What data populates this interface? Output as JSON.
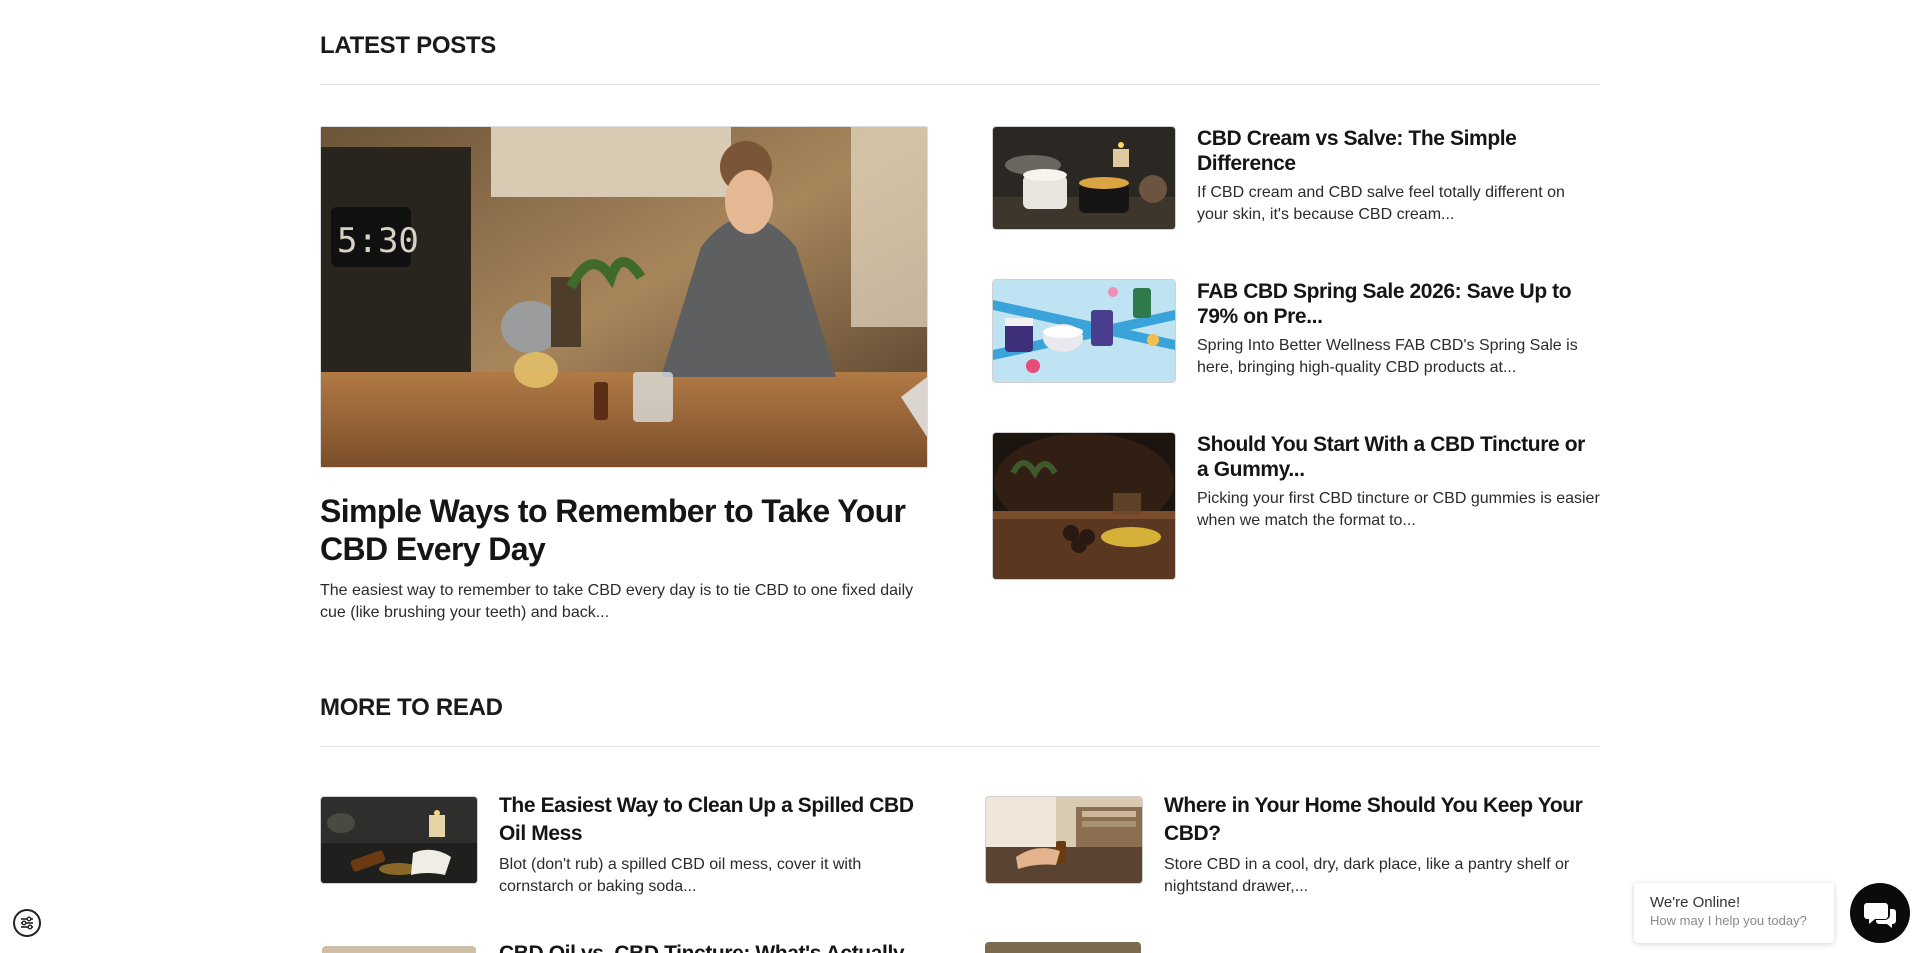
{
  "latest": {
    "section_title": "LATEST POSTS",
    "featured": {
      "title": "Simple Ways to Remember to Take Your CBD Every Day",
      "excerpt": "The easiest way to remember to take CBD every day is to tie CBD to one fixed daily cue (like brushing your teeth) and back...",
      "image_clock_text": "5:30"
    },
    "side_posts": [
      {
        "title": "CBD Cream vs Salve: The Simple Difference",
        "excerpt": "If CBD cream and CBD salve feel totally different on your skin, it's because CBD cream..."
      },
      {
        "title": "FAB CBD Spring Sale 2026: Save Up to 79% on Pre...",
        "excerpt": "Spring Into Better Wellness FAB CBD's Spring Sale is here, bringing high-quality CBD products at..."
      },
      {
        "title": "Should You Start With a CBD Tincture or a Gummy...",
        "excerpt": "Picking your first CBD tincture or CBD gummies is easier when we match the format to..."
      }
    ]
  },
  "more": {
    "section_title": "MORE TO READ",
    "posts": [
      {
        "title": "The Easiest Way to Clean Up a Spilled CBD Oil Mess",
        "excerpt": "Blot (don't rub) a spilled CBD oil mess, cover it with cornstarch or baking soda..."
      },
      {
        "title": "Where in Your Home Should You Keep Your CBD?",
        "excerpt": "Store CBD in a cool, dry, dark place, like a pantry shelf or nightstand drawer,..."
      }
    ],
    "partial_post_title": "CBD Oil vs. CBD Tincture: What's Actually"
  },
  "chat": {
    "status": "We're Online!",
    "prompt": "How may I help you today?"
  },
  "icons": {
    "chat": "chat-bubbles-icon",
    "accessibility": "accessibility-sliders-icon"
  }
}
